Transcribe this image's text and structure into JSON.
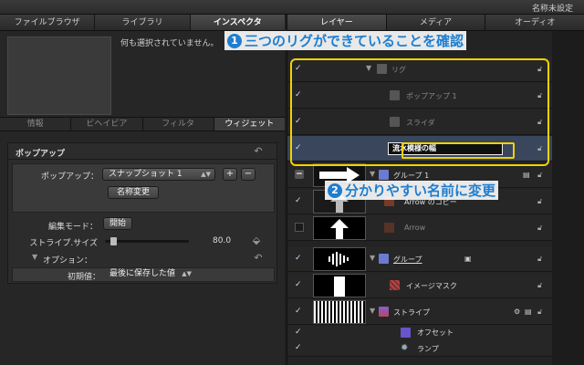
{
  "window": {
    "title": "名称未設定"
  },
  "left_tabs": [
    "ファイルブラウザ",
    "ライブラリ",
    "インスペクタ"
  ],
  "no_selection": "何も選択されていません。",
  "inspector_tabs": [
    "情報",
    "ビヘイビア",
    "フィルタ",
    "ウィジェット"
  ],
  "popup": {
    "section_label": "ポップアップ",
    "popup_label": "ポップアップ：",
    "popup_value": "スナップショット 1",
    "add": "+",
    "remove": "−",
    "rename_button": "名称変更",
    "edit_mode_label": "編集モード：",
    "edit_mode_button": "開始",
    "stripe_size_label": "ストライプ.サイズ",
    "stripe_size_value": "80.0",
    "stripe_size_fraction": 0.1,
    "option_label": "オプション：",
    "initial_label": "初期値：",
    "initial_value": "最後に保存した値"
  },
  "right_tabs": [
    "レイヤー",
    "メディア",
    "オーディオ"
  ],
  "layers": {
    "rig": "リグ",
    "popup1": "ポップアップ 1",
    "slider": "スライダ",
    "rename_value": "流水模様の幅",
    "group1": "グループ 1",
    "arrow_copy": "Arrow のコピー",
    "arrow": "Arrow",
    "group": "グループ",
    "image_mask": "イメージマスク",
    "stripe": "ストライプ",
    "offset": "オフセット",
    "lamp": "ランプ"
  },
  "annotations": {
    "one_num": "1",
    "one_text": "三つのリグができていることを確認",
    "two_num": "2",
    "two_text": "分かりやすい名前に変更"
  },
  "colors": {
    "annotation": "#1f7ecf",
    "highlight": "#f2d300",
    "selected_row": "#39465c"
  }
}
